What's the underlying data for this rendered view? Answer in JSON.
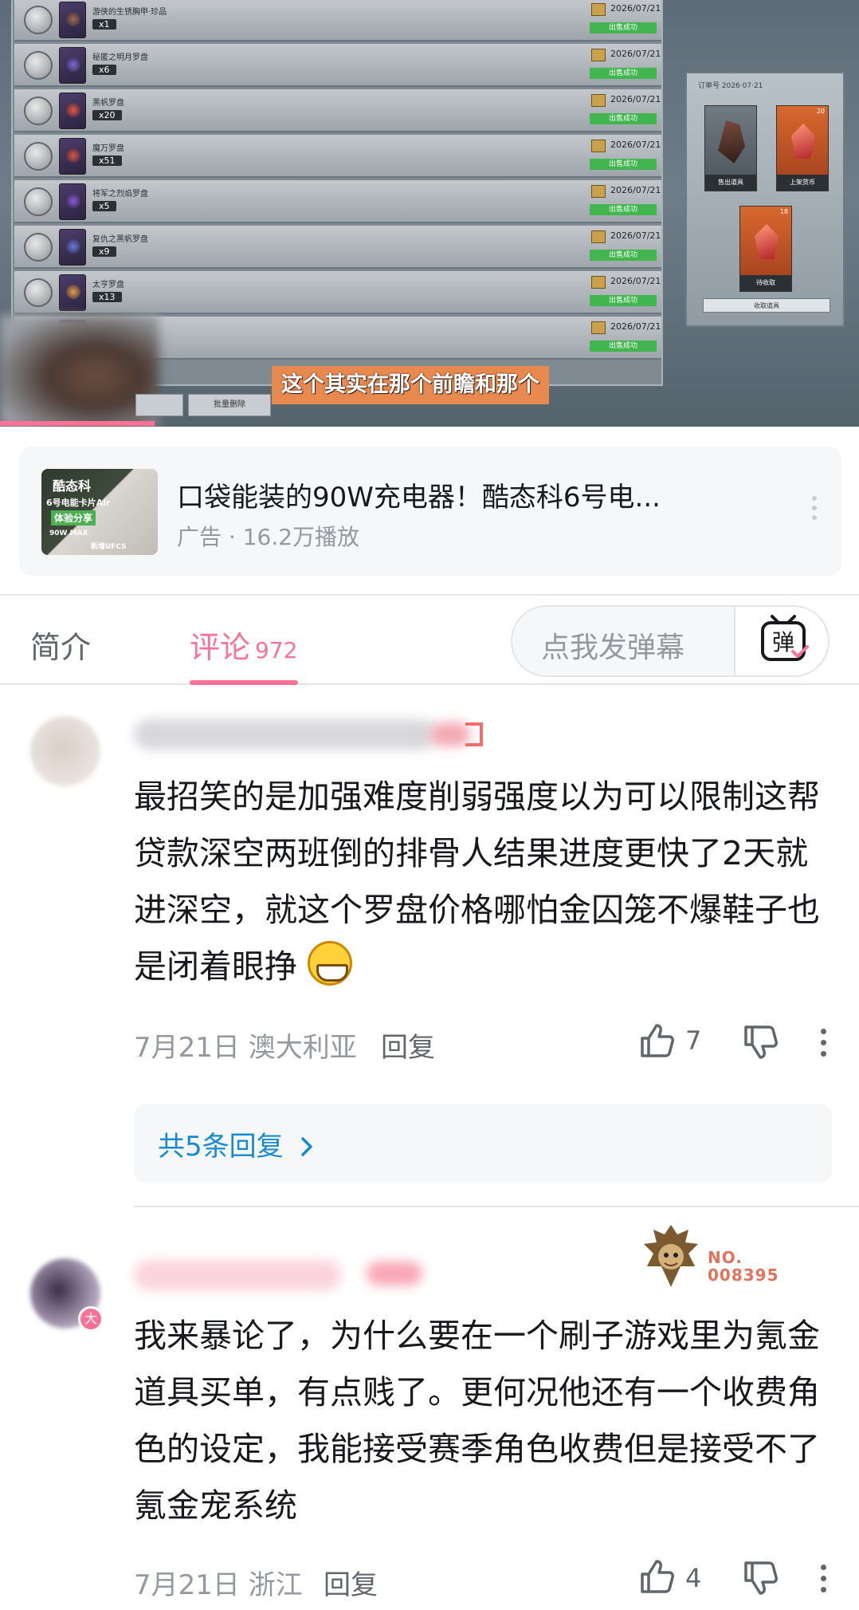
{
  "video": {
    "game_rows": [
      {
        "name": "游侠的生锈胸甲·珍品",
        "qty": "x1",
        "date": "2026/07/21",
        "status": "出售成功"
      },
      {
        "name": "秘匿之明月罗盘",
        "qty": "x6",
        "date": "2026/07/21",
        "status": "出售成功"
      },
      {
        "name": "黑帆罗盘",
        "qty": "x20",
        "date": "2026/07/21",
        "status": "出售成功"
      },
      {
        "name": "魔万罗盘",
        "qty": "x51",
        "date": "2026/07/21",
        "status": "出售成功"
      },
      {
        "name": "将军之烈焰罗盘",
        "qty": "x5",
        "date": "2026/07/21",
        "status": "出售成功"
      },
      {
        "name": "复仇之黑帆罗盘",
        "qty": "x9",
        "date": "2026/07/21",
        "status": "出售成功"
      },
      {
        "name": "太亨罗盘",
        "qty": "x13",
        "date": "2026/07/21",
        "status": "出售成功"
      },
      {
        "name": "",
        "qty": "",
        "date": "2026/07/21",
        "status": "出售成功"
      }
    ],
    "inventory": {
      "cards": [
        {
          "caption": "售出道具",
          "label": "游侠的生锈胸甲·珍品",
          "count": ""
        },
        {
          "caption": "上架货币",
          "label": "初火源质",
          "count": "20"
        },
        {
          "caption": "待收取",
          "label": "初火源质",
          "count": "18"
        }
      ],
      "collect_button": "收取道具"
    },
    "bottom_button": "批量删除",
    "subtitle": "这个其实在那个前瞻和那个",
    "progress": 0.18
  },
  "ad": {
    "thumb_lines": [
      "酷态科",
      "6号电能卡片Air",
      "体验分享",
      "90W MAX",
      "新增UFCS"
    ],
    "title": "口袋能装的90W充电器！酷态科6号电...",
    "meta": "广告 · 16.2万播放"
  },
  "tabs": {
    "intro": "简介",
    "comments": "评论",
    "comment_count": "972",
    "danmu_placeholder": "点我发弹幕",
    "danmu_icon_text": "弹"
  },
  "comments": [
    {
      "text": "最招笑的是加强难度削弱强度以为可以限制这帮贷款深空两班倒的排骨人结果进度更快了2天就进深空，就这个罗盘价格哪怕金囚笼不爆鞋子也是闭着眼挣",
      "date": "7月21日",
      "location": "澳大利亚",
      "reply_label": "回复",
      "likes": "7",
      "replies_summary": "共5条回复"
    },
    {
      "text": "我来暴论了，为什么要在一个刷子游戏里为氪金道具买单，有点贱了。更何况他还有一个收费角色的设定，我能接受赛季角色收费但是接受不了氪金宠系统",
      "date": "7月21日",
      "location": "浙江",
      "reply_label": "回复",
      "likes": "4",
      "badge": "大",
      "decoration_no": "NO.\n008395"
    }
  ],
  "colors": {
    "accent": "#fb7299",
    "link": "#178bcf",
    "meta": "#9499a0"
  }
}
